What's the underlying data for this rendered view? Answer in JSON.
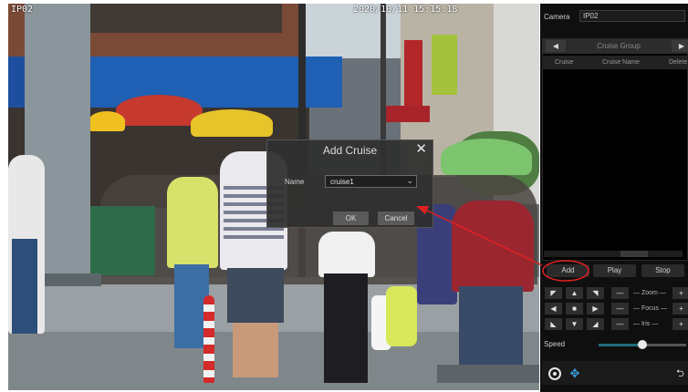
{
  "camera_view": {
    "label": "IP02",
    "timestamp": "2020/10/11 15:15:18"
  },
  "dialog": {
    "title": "Add Cruise",
    "close_glyph": "✕",
    "name_label": "Name",
    "name_value": "cruise1",
    "ok_label": "OK",
    "cancel_label": "Cancel"
  },
  "panel": {
    "camera_label": "Camera",
    "camera_value": "IP02",
    "cruise_group_label": "Cruise Group",
    "prev_glyph": "◀",
    "next_glyph": "▶",
    "table_headers": [
      "Cruise",
      "Cruise Name",
      "Delete"
    ],
    "add_label": "Add",
    "play_label": "Play",
    "stop_label": "Stop",
    "ptz_arrows": [
      "◤",
      "▲",
      "◥",
      "◀",
      "■",
      "▶",
      "◣",
      "▼",
      "◢"
    ],
    "zoom_label": "Zoom",
    "focus_label": "Focus",
    "iris_label": "Iris",
    "minus_glyph": "—",
    "plus_glyph": "+",
    "speed_label": "Speed",
    "speed_level_percent": 50,
    "move_glyph": "✥",
    "back_glyph": "⮌"
  },
  "annotation": {
    "color": "#e02020"
  },
  "icons": {
    "close": "close-icon",
    "dropdown": "chevron-down-icon",
    "record": "record-icon",
    "move": "move-icon",
    "back": "back-icon"
  }
}
